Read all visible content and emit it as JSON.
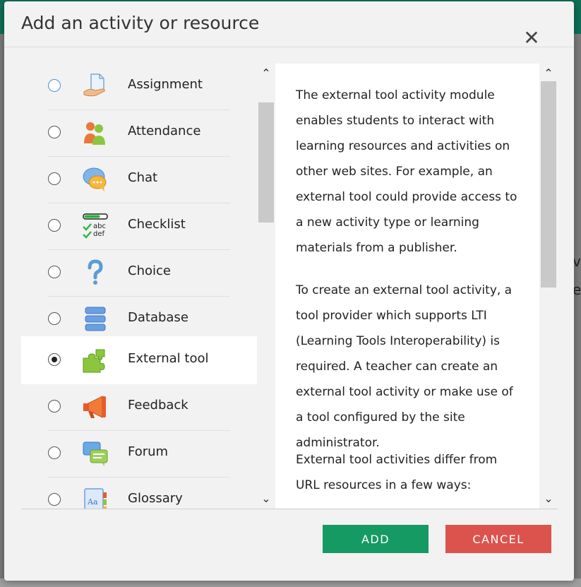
{
  "dialog": {
    "title": "Add an activity or resource",
    "close_symbol": "✕"
  },
  "options": [
    {
      "label": "Assignment",
      "icon": "assignment-icon",
      "selected": false
    },
    {
      "label": "Attendance",
      "icon": "attendance-icon",
      "selected": false
    },
    {
      "label": "Chat",
      "icon": "chat-icon",
      "selected": false
    },
    {
      "label": "Checklist",
      "icon": "checklist-icon",
      "selected": false,
      "icon_text": [
        "abc",
        "def"
      ]
    },
    {
      "label": "Choice",
      "icon": "choice-icon",
      "selected": false
    },
    {
      "label": "Database",
      "icon": "database-icon",
      "selected": false
    },
    {
      "label": "External tool",
      "icon": "external-tool-icon",
      "selected": true
    },
    {
      "label": "Feedback",
      "icon": "feedback-icon",
      "selected": false
    },
    {
      "label": "Forum",
      "icon": "forum-icon",
      "selected": false
    },
    {
      "label": "Glossary",
      "icon": "glossary-icon",
      "selected": false,
      "icon_text": [
        "Aa"
      ]
    }
  ],
  "description": {
    "paragraphs": [
      "The external tool activity module enables students to interact with learning resources and activities on other web sites. For example, an external tool could provide access to a new activity type or learning materials from a publisher.",
      "To create an external tool activity, a tool provider which supports LTI (Learning Tools Interoperability) is required. A teacher can create an external tool activity or make use of a tool configured by the site administrator.",
      "External tool activities differ from URL resources in a few ways:"
    ]
  },
  "scroll": {
    "up": "⌃",
    "down": "⌄"
  },
  "buttons": {
    "add": "ADD",
    "cancel": "CANCEL"
  },
  "colors": {
    "add_button": "#159a63",
    "cancel_button": "#dc534d",
    "header_strip": "#0f6e57"
  }
}
